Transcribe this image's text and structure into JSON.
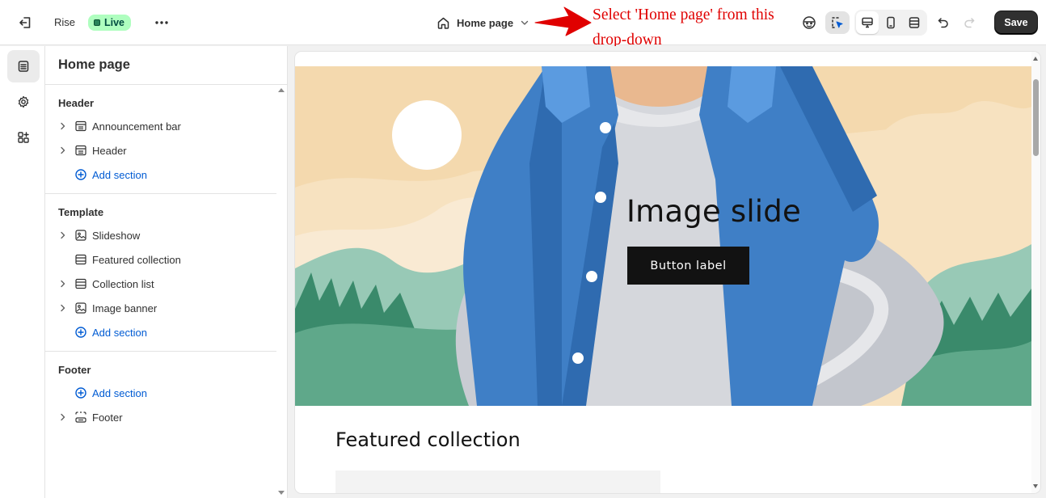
{
  "topbar": {
    "theme_name": "Rise",
    "status_badge": "Live",
    "page_selector": "Home page",
    "save_label": "Save"
  },
  "annotation": {
    "text": "Select 'Home page' from this drop-down",
    "color": "#e00000"
  },
  "sidebar": {
    "title": "Home page",
    "groups": [
      {
        "title": "Header",
        "items": [
          {
            "label": "Announcement bar",
            "expandable": true,
            "icon": "section-icon"
          },
          {
            "label": "Header",
            "expandable": true,
            "icon": "section-icon"
          }
        ],
        "add_label": "Add section"
      },
      {
        "title": "Template",
        "items": [
          {
            "label": "Slideshow",
            "expandable": true,
            "icon": "slideshow-icon"
          },
          {
            "label": "Featured collection",
            "expandable": false,
            "icon": "section-icon"
          },
          {
            "label": "Collection list",
            "expandable": true,
            "icon": "section-icon"
          },
          {
            "label": "Image banner",
            "expandable": true,
            "icon": "image-icon"
          }
        ],
        "add_label": "Add section"
      },
      {
        "title": "Footer",
        "add_label": "Add section",
        "items": [
          {
            "label": "Footer",
            "expandable": true,
            "icon": "footer-icon"
          }
        ]
      }
    ]
  },
  "preview": {
    "slide_heading": "Image slide",
    "slide_button": "Button label",
    "featured_title": "Featured collection"
  },
  "colors": {
    "accent_link": "#005bd3",
    "live_badge_bg": "#affebf",
    "save_bg": "#303030"
  }
}
